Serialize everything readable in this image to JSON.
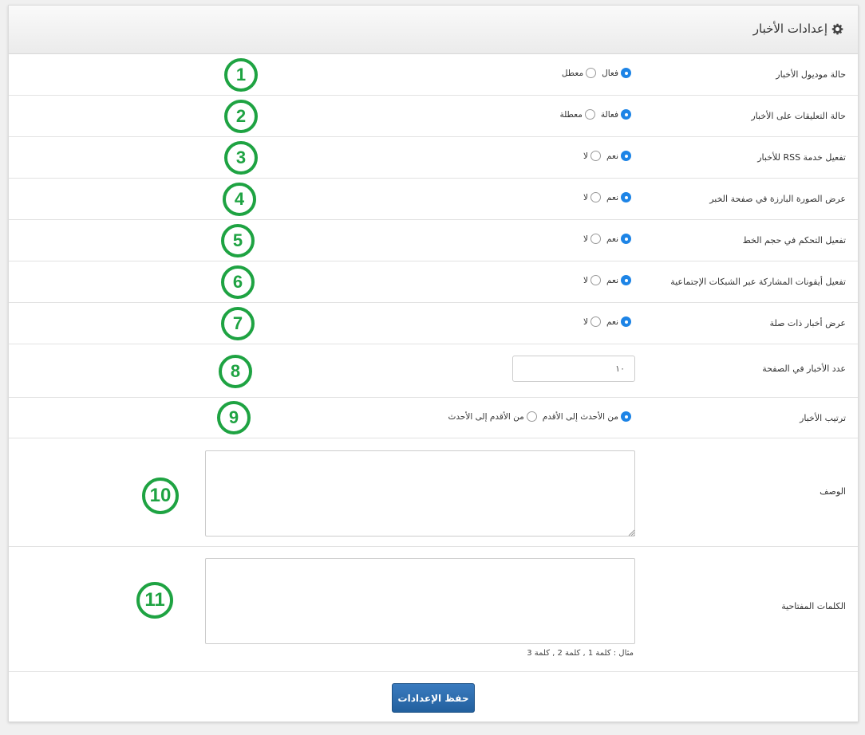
{
  "header": {
    "title": "إعدادات الأخبار",
    "icon": "gear-icon"
  },
  "rows": [
    {
      "label": "حالة موديول الأخبار",
      "options": [
        "فعال",
        "معطل"
      ],
      "selected": 0,
      "badge": "1"
    },
    {
      "label": "حالة التعليقات على الأخبار",
      "options": [
        "فعالة",
        "معطلة"
      ],
      "selected": 0,
      "badge": "2"
    },
    {
      "label": "تفعيل خدمة RSS للأخبار",
      "options": [
        "نعم",
        "لا"
      ],
      "selected": 0,
      "badge": "3"
    },
    {
      "label": "عرض الصورة البارزة في صفحة الخبر",
      "options": [
        "نعم",
        "لا"
      ],
      "selected": 0,
      "badge": "4"
    },
    {
      "label": "تفعيل التحكم في حجم الخط",
      "options": [
        "نعم",
        "لا"
      ],
      "selected": 0,
      "badge": "5"
    },
    {
      "label": "تفعيل أيقونات المشاركة عبر الشبكات الإجتماعية",
      "options": [
        "نعم",
        "لا"
      ],
      "selected": 0,
      "badge": "6"
    },
    {
      "label": "عرض أخبار ذات صلة",
      "options": [
        "نعم",
        "لا"
      ],
      "selected": 0,
      "badge": "7"
    }
  ],
  "per_page": {
    "label": "عدد الأخبار في الصفحة",
    "value": "١٠",
    "badge": "8"
  },
  "order": {
    "label": "ترتيب الأخبار",
    "options": [
      "من الأحدث إلى الأقدم",
      "من الأقدم إلى الأحدث"
    ],
    "selected": 0,
    "badge": "9"
  },
  "description": {
    "label": "الوصف",
    "value": "",
    "badge": "10"
  },
  "keywords": {
    "label": "الكلمات المفتاحية",
    "value": "",
    "hint": "مثال : كلمة 1 , كلمة 2 , كلمة 3",
    "badge": "11"
  },
  "save_label": "حفظ الإعدادات",
  "colors": {
    "accent": "#1d84e6",
    "badge": "#1ea342",
    "button": "#2b6aaa"
  }
}
